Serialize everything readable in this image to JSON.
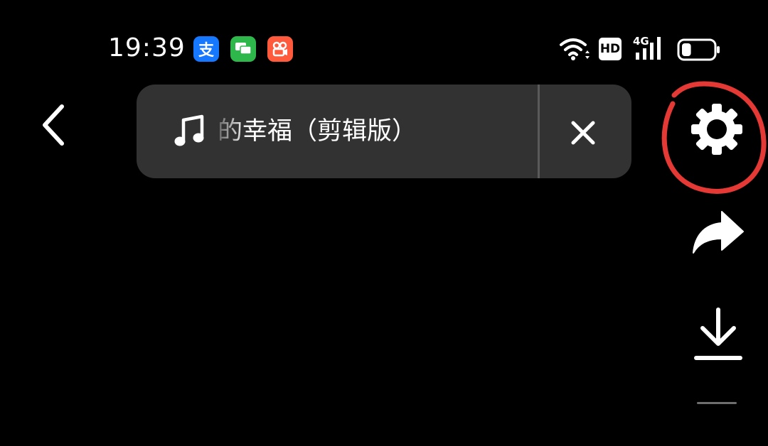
{
  "status_bar": {
    "time": "19:39",
    "hd_badge": "HD",
    "network_label": "4G",
    "notification_icons": [
      {
        "name": "alipay-icon",
        "glyph": "支",
        "color": "#1677ff"
      },
      {
        "name": "messages-icon",
        "color": "#2eb84b"
      },
      {
        "name": "kuaishou-icon",
        "color": "#ff5a3c"
      }
    ],
    "battery_level": 0.3
  },
  "music_bar": {
    "title": "的幸福（剪辑版）"
  },
  "icons": {
    "back": "chevron-left-icon",
    "music": "music-note-icon",
    "close": "close-icon",
    "settings": "gear-icon",
    "share": "share-arrow-icon",
    "download": "download-icon"
  },
  "colors": {
    "background": "#000000",
    "music_bar_bg": "#323232",
    "annotation_red": "#e53935",
    "icon_white": "#ffffff"
  }
}
